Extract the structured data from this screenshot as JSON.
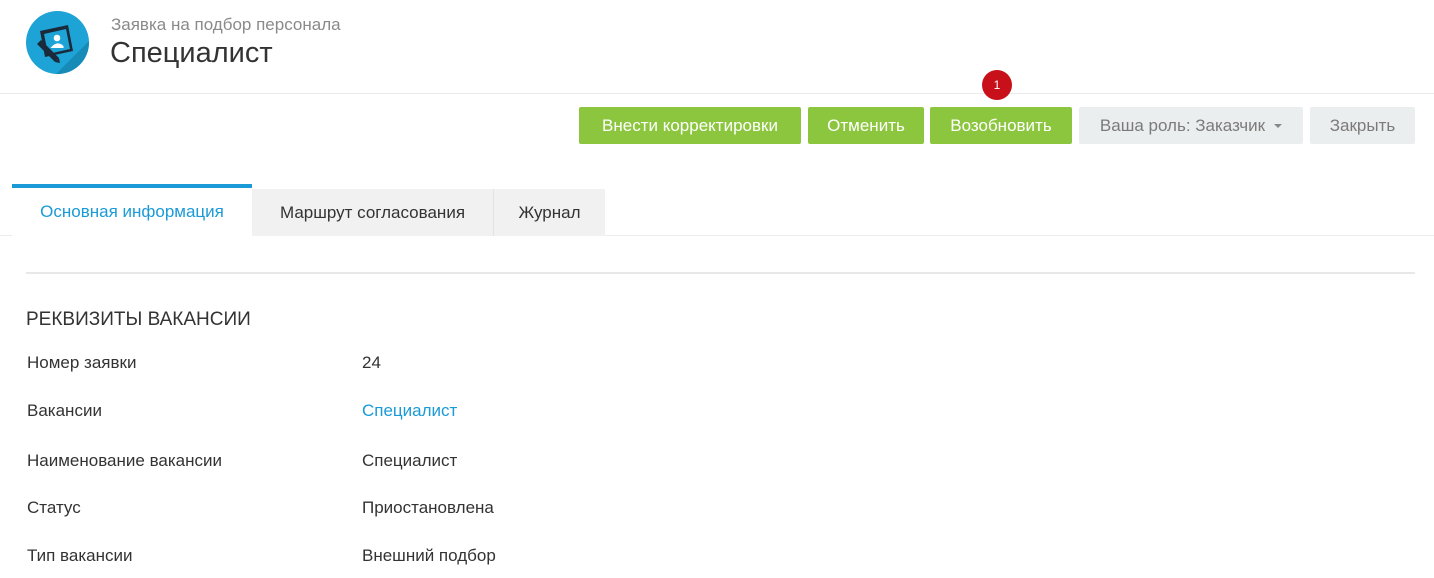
{
  "header": {
    "subtitle": "Заявка на подбор персонала",
    "title": "Специалист",
    "logo_icon": "recruitment-request-icon"
  },
  "toolbar": {
    "make_corrections_label": "Внести корректировки",
    "cancel_label": "Отменить",
    "resume_label": "Возобновить",
    "resume_badge": "1",
    "role_label": "Ваша роль: Заказчик",
    "close_label": "Закрыть"
  },
  "tabs": [
    {
      "label": "Основная информация",
      "active": true
    },
    {
      "label": "Маршрут согласования",
      "active": false
    },
    {
      "label": "Журнал",
      "active": false
    }
  ],
  "section": {
    "title": "РЕКВИЗИТЫ ВАКАНСИИ",
    "fields": [
      {
        "label": "Номер заявки",
        "value": "24"
      },
      {
        "label": "Вакансии",
        "value": "Специалист",
        "link": true
      },
      {
        "label": "Наименование вакансии",
        "value": "Специалист"
      },
      {
        "label": "Статус",
        "value": "Приостановлена"
      },
      {
        "label": "Тип вакансии",
        "value": "Внешний подбор"
      }
    ]
  },
  "colors": {
    "accent": "#1a9ad6",
    "green": "#8cc63f",
    "badge": "#c8101a",
    "gray_button": "#ebeeee"
  }
}
